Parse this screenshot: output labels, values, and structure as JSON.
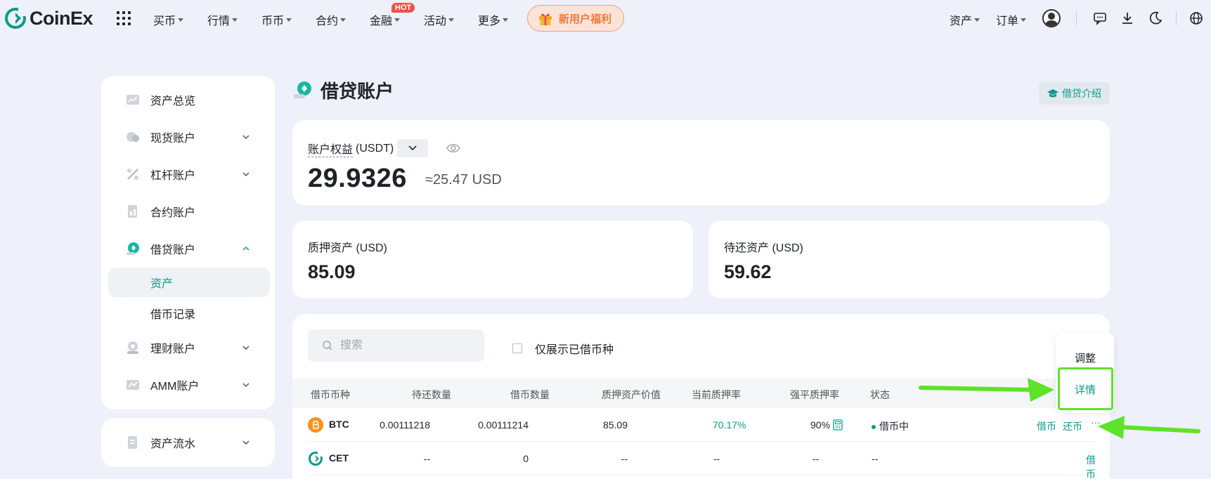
{
  "brand": {
    "name": "CoinEx",
    "accent": "#0d9b8a"
  },
  "nav": {
    "items": [
      "买币",
      "行情",
      "币币",
      "合约",
      "金融",
      "活动",
      "更多"
    ],
    "hot_badge": "HOT",
    "promo": "新用户福利",
    "right": {
      "assets": "资产",
      "orders": "订单"
    }
  },
  "sidebar": {
    "items": [
      "资产总览",
      "现货账户",
      "杠杆账户",
      "合约账户",
      "借贷账户",
      "理财账户",
      "AMM账户"
    ],
    "sub_items": [
      "资产",
      "借币记录"
    ],
    "bottom_item": "资产流水"
  },
  "page": {
    "title": "借贷账户",
    "intro_button": "借贷介绍"
  },
  "equity": {
    "label": "账户权益",
    "unit": "(USDT)",
    "value": "29.9326",
    "approx": "≈25.47 USD"
  },
  "stats": {
    "collateral_label": "质押资产 (USD)",
    "collateral_value": "85.09",
    "pending_label": "待还资产 (USD)",
    "pending_value": "59.62"
  },
  "table": {
    "search_placeholder": "搜索",
    "filter_label": "仅展示已借币种",
    "headers": [
      "借币币种",
      "待还数量",
      "借币数量",
      "质押资产价值",
      "当前质押率",
      "强平质押率",
      "状态"
    ],
    "rows": [
      {
        "coin": "BTC",
        "pending": "0.00111218",
        "borrowed": "0.00111214",
        "collateral_value": "85.09",
        "current_rate": "70.17%",
        "liq_rate": "90%",
        "status": "借币中",
        "actions": [
          "借币",
          "还币",
          "···"
        ]
      },
      {
        "coin": "CET",
        "pending": "--",
        "borrowed": "0",
        "collateral_value": "--",
        "current_rate": "--",
        "liq_rate": "--",
        "status": "--",
        "actions": [
          "借币"
        ]
      }
    ]
  },
  "dropdown": {
    "items": [
      "调整",
      "详情"
    ]
  }
}
